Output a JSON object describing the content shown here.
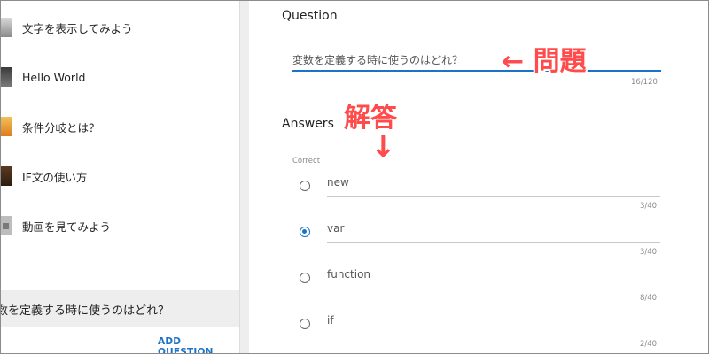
{
  "sidebar": {
    "items": [
      {
        "label": "文字を表示してみよう"
      },
      {
        "label": "Hello World"
      },
      {
        "label": "条件分岐とは？"
      },
      {
        "label": "IF文の使い方"
      },
      {
        "label": "動画を見てみよう"
      }
    ],
    "current_question": "数を定義する時に使うのはどれ？",
    "add_question_label": "ADD QUESTION"
  },
  "question": {
    "title": "Question",
    "value": "変数を定義する時に使うのはどれ？",
    "counter": "16/120"
  },
  "answers": {
    "title": "Answers",
    "correct_label": "Correct",
    "items": [
      {
        "value": "new",
        "counter": "3/40",
        "correct": false
      },
      {
        "value": "var",
        "counter": "3/40",
        "correct": true
      },
      {
        "value": "function",
        "counter": "8/40",
        "correct": false
      },
      {
        "value": "if",
        "counter": "2/40",
        "correct": false
      }
    ]
  },
  "annotations": {
    "question_note": "← 問題",
    "answer_note": "解答",
    "answer_arrow": "↓"
  },
  "colors": {
    "accent": "#1a73c8",
    "annotation": "#ff4b4b",
    "selected_bg": "#eeeeee"
  }
}
